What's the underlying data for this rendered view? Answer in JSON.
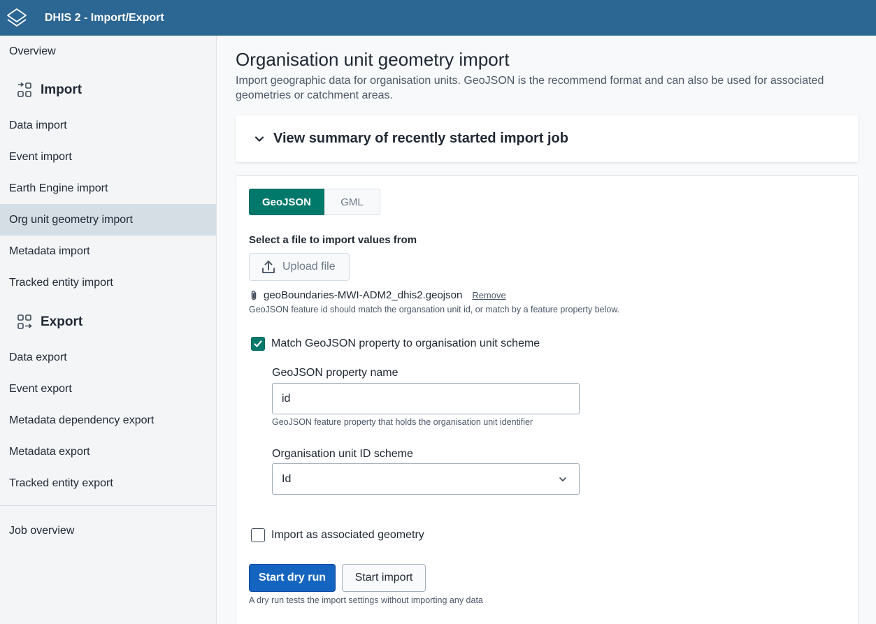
{
  "header": {
    "app_title": "DHIS 2 - Import/Export",
    "logo_icon": "dhis2-logo-icon",
    "background_color": "#2c6693"
  },
  "sidebar": {
    "overview": "Overview",
    "import_section": {
      "label": "Import",
      "icon": "import-icon"
    },
    "import_items": [
      {
        "label": "Data import"
      },
      {
        "label": "Event import"
      },
      {
        "label": "Earth Engine import"
      },
      {
        "label": "Org unit geometry import",
        "active": true
      },
      {
        "label": "Metadata import"
      },
      {
        "label": "Tracked entity import"
      }
    ],
    "export_section": {
      "label": "Export",
      "icon": "export-icon"
    },
    "export_items": [
      {
        "label": "Data export"
      },
      {
        "label": "Event export"
      },
      {
        "label": "Metadata dependency export"
      },
      {
        "label": "Metadata export"
      },
      {
        "label": "Tracked entity export"
      }
    ],
    "job_overview": "Job overview"
  },
  "main": {
    "title": "Organisation unit geometry import",
    "description": "Import geographic data for organisation units. GeoJSON is the recommend format and can also be used for associated geometries or catchment areas.",
    "summary_toggle": "View summary of recently started import job",
    "format_tabs": [
      {
        "label": "GeoJSON",
        "selected": true
      },
      {
        "label": "GML",
        "selected": false
      }
    ],
    "file_section_label": "Select a file to import values from",
    "upload_button": "Upload file",
    "selected_file": "geoBoundaries-MWI-ADM2_dhis2.geojson",
    "remove_link": "Remove",
    "file_help": "GeoJSON feature id should match the organsation unit id, or match by a feature property below.",
    "match_checkbox": {
      "label": "Match GeoJSON property to organisation unit scheme",
      "checked": true
    },
    "property_name": {
      "label": "GeoJSON property name",
      "value": "id",
      "help": "GeoJSON feature property that holds the organisation unit identifier"
    },
    "id_scheme": {
      "label": "Organisation unit ID scheme",
      "selected": "Id"
    },
    "associated_checkbox": {
      "label": "Import as associated geometry",
      "checked": false
    },
    "dry_run_button": "Start dry run",
    "import_button": "Start import",
    "dry_run_help": "A dry run tests the import settings without importing any data"
  },
  "colors": {
    "accent_teal": "#00796b",
    "primary_blue": "#1565c0",
    "active_nav_bg": "#d5dde5"
  }
}
